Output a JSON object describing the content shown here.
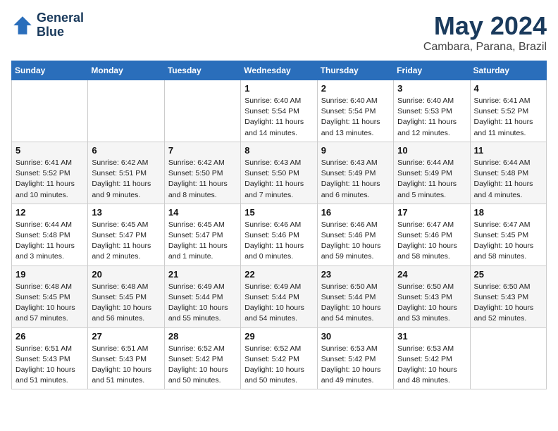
{
  "header": {
    "logo_line1": "General",
    "logo_line2": "Blue",
    "month_title": "May 2024",
    "location": "Cambara, Parana, Brazil"
  },
  "weekdays": [
    "Sunday",
    "Monday",
    "Tuesday",
    "Wednesday",
    "Thursday",
    "Friday",
    "Saturday"
  ],
  "weeks": [
    [
      {
        "day": "",
        "info": ""
      },
      {
        "day": "",
        "info": ""
      },
      {
        "day": "",
        "info": ""
      },
      {
        "day": "1",
        "info": "Sunrise: 6:40 AM\nSunset: 5:54 PM\nDaylight: 11 hours\nand 14 minutes."
      },
      {
        "day": "2",
        "info": "Sunrise: 6:40 AM\nSunset: 5:54 PM\nDaylight: 11 hours\nand 13 minutes."
      },
      {
        "day": "3",
        "info": "Sunrise: 6:40 AM\nSunset: 5:53 PM\nDaylight: 11 hours\nand 12 minutes."
      },
      {
        "day": "4",
        "info": "Sunrise: 6:41 AM\nSunset: 5:52 PM\nDaylight: 11 hours\nand 11 minutes."
      }
    ],
    [
      {
        "day": "5",
        "info": "Sunrise: 6:41 AM\nSunset: 5:52 PM\nDaylight: 11 hours\nand 10 minutes."
      },
      {
        "day": "6",
        "info": "Sunrise: 6:42 AM\nSunset: 5:51 PM\nDaylight: 11 hours\nand 9 minutes."
      },
      {
        "day": "7",
        "info": "Sunrise: 6:42 AM\nSunset: 5:50 PM\nDaylight: 11 hours\nand 8 minutes."
      },
      {
        "day": "8",
        "info": "Sunrise: 6:43 AM\nSunset: 5:50 PM\nDaylight: 11 hours\nand 7 minutes."
      },
      {
        "day": "9",
        "info": "Sunrise: 6:43 AM\nSunset: 5:49 PM\nDaylight: 11 hours\nand 6 minutes."
      },
      {
        "day": "10",
        "info": "Sunrise: 6:44 AM\nSunset: 5:49 PM\nDaylight: 11 hours\nand 5 minutes."
      },
      {
        "day": "11",
        "info": "Sunrise: 6:44 AM\nSunset: 5:48 PM\nDaylight: 11 hours\nand 4 minutes."
      }
    ],
    [
      {
        "day": "12",
        "info": "Sunrise: 6:44 AM\nSunset: 5:48 PM\nDaylight: 11 hours\nand 3 minutes."
      },
      {
        "day": "13",
        "info": "Sunrise: 6:45 AM\nSunset: 5:47 PM\nDaylight: 11 hours\nand 2 minutes."
      },
      {
        "day": "14",
        "info": "Sunrise: 6:45 AM\nSunset: 5:47 PM\nDaylight: 11 hours\nand 1 minute."
      },
      {
        "day": "15",
        "info": "Sunrise: 6:46 AM\nSunset: 5:46 PM\nDaylight: 11 hours\nand 0 minutes."
      },
      {
        "day": "16",
        "info": "Sunrise: 6:46 AM\nSunset: 5:46 PM\nDaylight: 10 hours\nand 59 minutes."
      },
      {
        "day": "17",
        "info": "Sunrise: 6:47 AM\nSunset: 5:46 PM\nDaylight: 10 hours\nand 58 minutes."
      },
      {
        "day": "18",
        "info": "Sunrise: 6:47 AM\nSunset: 5:45 PM\nDaylight: 10 hours\nand 58 minutes."
      }
    ],
    [
      {
        "day": "19",
        "info": "Sunrise: 6:48 AM\nSunset: 5:45 PM\nDaylight: 10 hours\nand 57 minutes."
      },
      {
        "day": "20",
        "info": "Sunrise: 6:48 AM\nSunset: 5:45 PM\nDaylight: 10 hours\nand 56 minutes."
      },
      {
        "day": "21",
        "info": "Sunrise: 6:49 AM\nSunset: 5:44 PM\nDaylight: 10 hours\nand 55 minutes."
      },
      {
        "day": "22",
        "info": "Sunrise: 6:49 AM\nSunset: 5:44 PM\nDaylight: 10 hours\nand 54 minutes."
      },
      {
        "day": "23",
        "info": "Sunrise: 6:50 AM\nSunset: 5:44 PM\nDaylight: 10 hours\nand 54 minutes."
      },
      {
        "day": "24",
        "info": "Sunrise: 6:50 AM\nSunset: 5:43 PM\nDaylight: 10 hours\nand 53 minutes."
      },
      {
        "day": "25",
        "info": "Sunrise: 6:50 AM\nSunset: 5:43 PM\nDaylight: 10 hours\nand 52 minutes."
      }
    ],
    [
      {
        "day": "26",
        "info": "Sunrise: 6:51 AM\nSunset: 5:43 PM\nDaylight: 10 hours\nand 51 minutes."
      },
      {
        "day": "27",
        "info": "Sunrise: 6:51 AM\nSunset: 5:43 PM\nDaylight: 10 hours\nand 51 minutes."
      },
      {
        "day": "28",
        "info": "Sunrise: 6:52 AM\nSunset: 5:42 PM\nDaylight: 10 hours\nand 50 minutes."
      },
      {
        "day": "29",
        "info": "Sunrise: 6:52 AM\nSunset: 5:42 PM\nDaylight: 10 hours\nand 50 minutes."
      },
      {
        "day": "30",
        "info": "Sunrise: 6:53 AM\nSunset: 5:42 PM\nDaylight: 10 hours\nand 49 minutes."
      },
      {
        "day": "31",
        "info": "Sunrise: 6:53 AM\nSunset: 5:42 PM\nDaylight: 10 hours\nand 48 minutes."
      },
      {
        "day": "",
        "info": ""
      }
    ]
  ]
}
